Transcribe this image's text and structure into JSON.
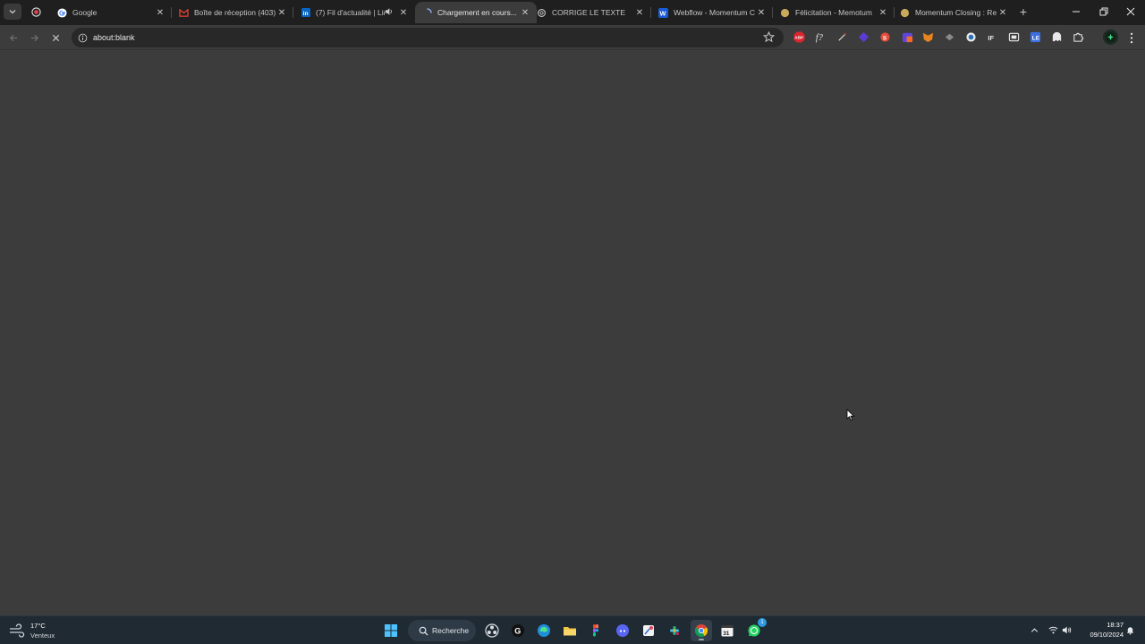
{
  "browser": {
    "tabs": [
      {
        "title": "Google",
        "favicon": "google-icon",
        "active": false
      },
      {
        "title": "Boîte de réception (403)",
        "favicon": "gmail-icon",
        "active": false
      },
      {
        "title": "(7) Fil d'actualité | Lin",
        "favicon": "linkedin-icon",
        "active": false,
        "audio": true
      },
      {
        "title": "Chargement en cours...",
        "favicon": "loading-spinner-icon",
        "active": true
      },
      {
        "title": "CORRIGE LE TEXTE",
        "favicon": "openai-icon",
        "active": false
      },
      {
        "title": "Webflow - Momentum C",
        "favicon": "webflow-icon",
        "active": false
      },
      {
        "title": "Félicitation - Memotum",
        "favicon": "site-circle-icon",
        "active": false
      },
      {
        "title": "Momentum Closing : Re",
        "favicon": "site-circle-icon",
        "active": false
      }
    ],
    "address": {
      "url": "about:blank"
    },
    "extensions": [
      "adblock-icon",
      "formula-icon",
      "pen-icon",
      "purple-gem-icon",
      "red-ext-icon",
      "calendar-ext-icon",
      "fox-icon",
      "arrow-ext-icon",
      "globe-ext-icon",
      "text-ext-icon",
      "screenshot-ext-icon",
      "blue-ext-icon",
      "ghost-ext-icon",
      "puzzle-icon"
    ],
    "accent_color": "#3c3c3c"
  },
  "taskbar": {
    "weather": {
      "temp": "17°C",
      "condition": "Venteux"
    },
    "search_label": "Recherche",
    "apps": [
      "windows-start-icon",
      "obs-icon",
      "app-g-icon",
      "edge-icon",
      "file-explorer-icon",
      "figma-icon",
      "discord-icon",
      "snipping-icon",
      "slack-icon",
      "chrome-icon",
      "calendar-icon",
      "whatsapp-icon"
    ],
    "whatsapp_badge": "1",
    "clock": {
      "time": "18:37",
      "date": "09/10/2024"
    }
  }
}
